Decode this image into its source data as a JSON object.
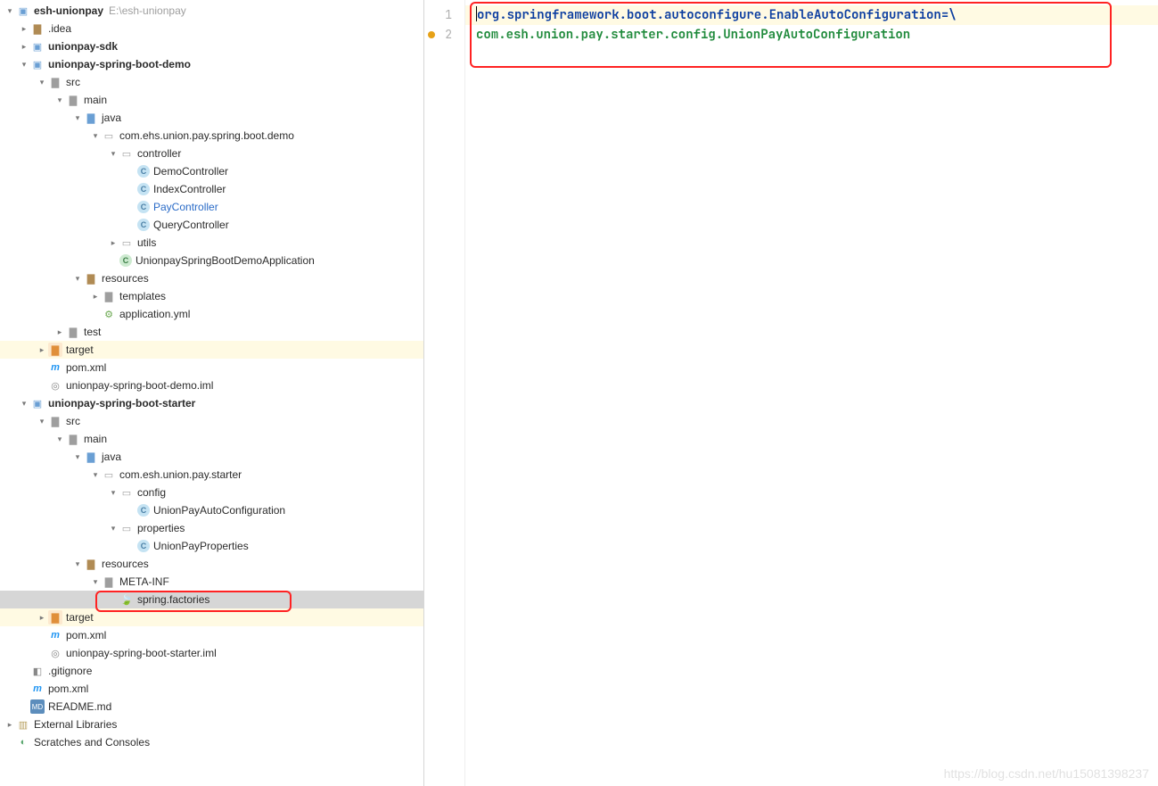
{
  "project": {
    "root_name": "esh-unionpay",
    "root_path": "E:\\esh-unionpay",
    "idea_folder": ".idea",
    "unionpay_sdk": "unionpay-sdk",
    "demo_module": {
      "name": "unionpay-spring-boot-demo",
      "src": "src",
      "main": "main",
      "java": "java",
      "package": "com.ehs.union.pay.spring.boot.demo",
      "controller": "controller",
      "controllers": {
        "demo": "DemoController",
        "index": "IndexController",
        "pay": "PayController",
        "query": "QueryController"
      },
      "utils": "utils",
      "app_class": "UnionpaySpringBootDemoApplication",
      "resources": "resources",
      "templates": "templates",
      "app_yml": "application.yml",
      "test": "test",
      "target": "target",
      "pom": "pom.xml",
      "iml": "unionpay-spring-boot-demo.iml"
    },
    "starter_module": {
      "name": "unionpay-spring-boot-starter",
      "src": "src",
      "main": "main",
      "java": "java",
      "package": "com.esh.union.pay.starter",
      "config_pkg": "config",
      "config_class": "UnionPayAutoConfiguration",
      "props_pkg": "properties",
      "props_class": "UnionPayProperties",
      "resources": "resources",
      "metainf": "META-INF",
      "factories": "spring.factories",
      "target": "target",
      "pom": "pom.xml",
      "iml": "unionpay-spring-boot-starter.iml"
    },
    "gitignore": ".gitignore",
    "root_pom": "pom.xml",
    "readme": "README.md",
    "ext_lib": "External Libraries",
    "scratches": "Scratches and Consoles"
  },
  "editor": {
    "line_numbers": [
      "1",
      "2"
    ],
    "line1_key": "org.springframework.boot.autoconfigure.EnableAutoConfiguration",
    "line1_eq": "=",
    "line1_cont": "\\",
    "line2_val": "com.esh.union.pay.starter.config.UnionPayAutoConfiguration"
  },
  "watermark": "https://blog.csdn.net/hu15081398237"
}
